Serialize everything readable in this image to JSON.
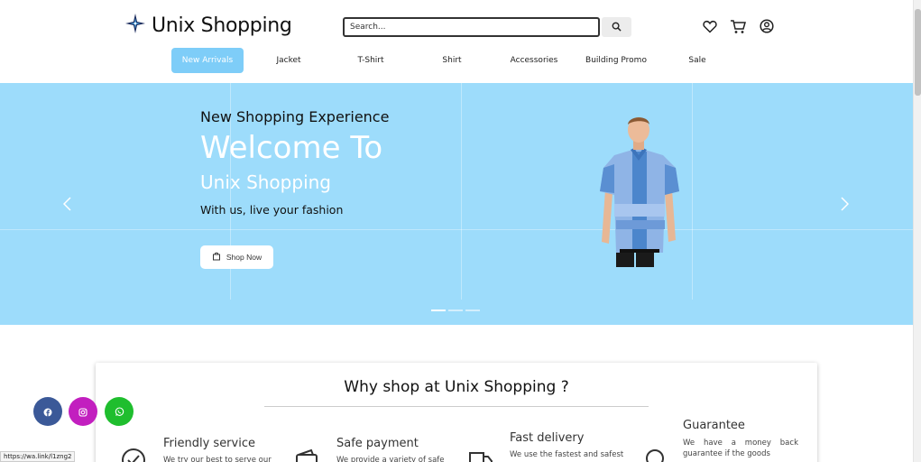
{
  "header": {
    "logo_text": "Unix Shopping",
    "search_placeholder": "Search...",
    "icons": [
      "heart-icon",
      "cart-icon",
      "user-icon"
    ]
  },
  "nav": {
    "items": [
      {
        "label": "New Arrivals",
        "active": true
      },
      {
        "label": "Jacket"
      },
      {
        "label": "T-Shirt"
      },
      {
        "label": "Shirt"
      },
      {
        "label": "Accessories"
      },
      {
        "label": "Building Promo"
      },
      {
        "label": "Sale"
      }
    ]
  },
  "hero": {
    "subtitle": "New Shopping Experience",
    "title": "Welcome To",
    "brand": "Unix Shopping",
    "tagline": "With us, live your fashion",
    "button_label": "Shop Now",
    "background": "#9ddcfb",
    "slides": 3,
    "active_slide": 1
  },
  "why": {
    "title": "Why shop at Unix Shopping ?",
    "features": [
      {
        "title": "Friendly service",
        "desc": "We try our best to serve our",
        "icon": "check-circle-icon"
      },
      {
        "title": "Safe payment",
        "desc": "We provide a variety of safe",
        "icon": "wallet-icon"
      },
      {
        "title": "Fast delivery",
        "desc": "We use the fastest and safest",
        "icon": "truck-icon"
      },
      {
        "title": "Guarantee",
        "desc": "We have a money back guarantee if the goods",
        "icon": "badge-icon"
      }
    ]
  },
  "social": {
    "facebook_color": "#3b5998",
    "instagram_color": "#c21fbf",
    "whatsapp_color": "#1fbe2e"
  },
  "status_bar": {
    "url": "https://wa.link/l1zng2"
  },
  "colors": {
    "accent": "#7ecdf8"
  }
}
